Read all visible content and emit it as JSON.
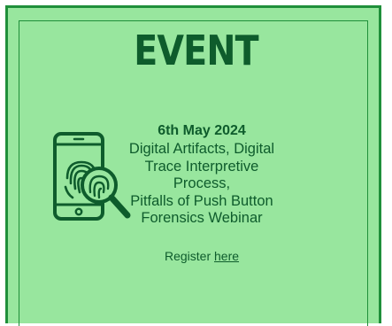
{
  "event": {
    "title": "EVENT",
    "date": "6th May 2024",
    "description_lines": [
      "Digital Artifacts, Digital",
      "Trace Interpretive Process,",
      "Pitfalls of Push Button",
      "Forensics Webinar"
    ],
    "register_prefix": "Register ",
    "register_link": "here"
  },
  "colors": {
    "background": "#98e69e",
    "border": "#1f8f3a",
    "text": "#0e5c2c"
  },
  "icon": "phone-fingerprint-magnifier-icon"
}
